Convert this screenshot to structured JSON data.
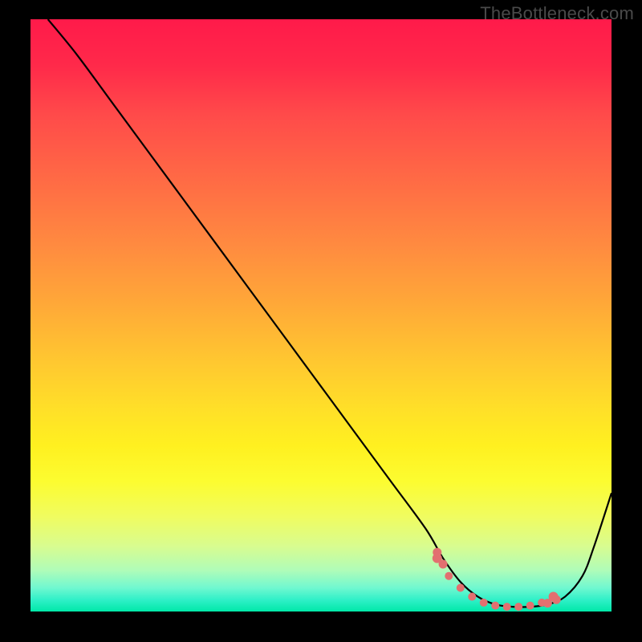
{
  "watermark": "TheBottleneck.com",
  "chart_data": {
    "type": "line",
    "title": "",
    "xlabel": "",
    "ylabel": "",
    "xlim": [
      0,
      100
    ],
    "ylim": [
      0,
      100
    ],
    "curve": {
      "x": [
        3,
        8,
        14,
        20,
        26,
        32,
        38,
        44,
        50,
        56,
        62,
        68,
        71,
        74,
        77,
        80,
        83,
        86,
        89,
        92,
        95,
        97,
        100
      ],
      "y": [
        100,
        94,
        86,
        78,
        70,
        62,
        54,
        46,
        38,
        30,
        22,
        14,
        9,
        5,
        2.5,
        1.2,
        0.8,
        0.8,
        1.2,
        2.5,
        6,
        11,
        20
      ]
    },
    "markers": {
      "x": [
        70,
        72,
        74,
        76,
        78,
        80,
        82,
        84,
        86,
        88,
        90
      ],
      "y": [
        9,
        6,
        4,
        2.5,
        1.5,
        1,
        0.8,
        0.8,
        1,
        1.5,
        2.5
      ],
      "color": "#e27070"
    }
  }
}
